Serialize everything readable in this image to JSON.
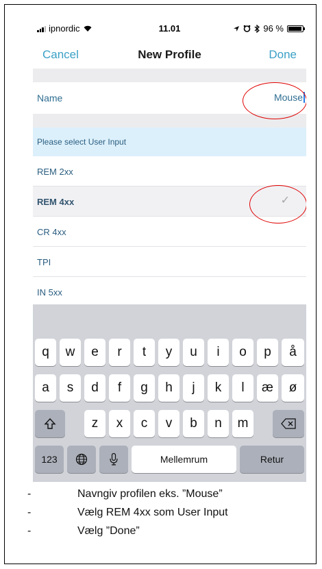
{
  "status_bar": {
    "carrier": "ipnordic",
    "time": "11.01",
    "battery": "96 %"
  },
  "nav": {
    "cancel": "Cancel",
    "title": "New Profile",
    "done": "Done"
  },
  "name_row": {
    "label": "Name",
    "value": "Mouse"
  },
  "section_header": "Please select User Input",
  "options": [
    {
      "label": "REM 2xx",
      "selected": false
    },
    {
      "label": "REM 4xx",
      "selected": true
    },
    {
      "label": "CR 4xx",
      "selected": false
    },
    {
      "label": "TPI",
      "selected": false
    },
    {
      "label": "IN 5xx",
      "selected": false
    }
  ],
  "keyboard": {
    "row1": [
      "q",
      "w",
      "e",
      "r",
      "t",
      "y",
      "u",
      "i",
      "o",
      "p",
      "å"
    ],
    "row2": [
      "a",
      "s",
      "d",
      "f",
      "g",
      "h",
      "j",
      "k",
      "l",
      "æ",
      "ø"
    ],
    "row3": [
      "z",
      "x",
      "c",
      "v",
      "b",
      "n",
      "m"
    ],
    "numbers_key": "123",
    "space_key": "Mellemrum",
    "return_key": "Retur"
  },
  "instructions": [
    {
      "dash": "-",
      "text": "Navngiv profilen eks. ”Mouse”"
    },
    {
      "dash": "-",
      "text": "Vælg REM 4xx som User Input"
    },
    {
      "dash": "-",
      "text": "Vælg ”Done”"
    }
  ],
  "colors": {
    "accent": "#3aa0c6",
    "highlight_circle": "#e00000",
    "section_bg": "#dcf0fb"
  }
}
